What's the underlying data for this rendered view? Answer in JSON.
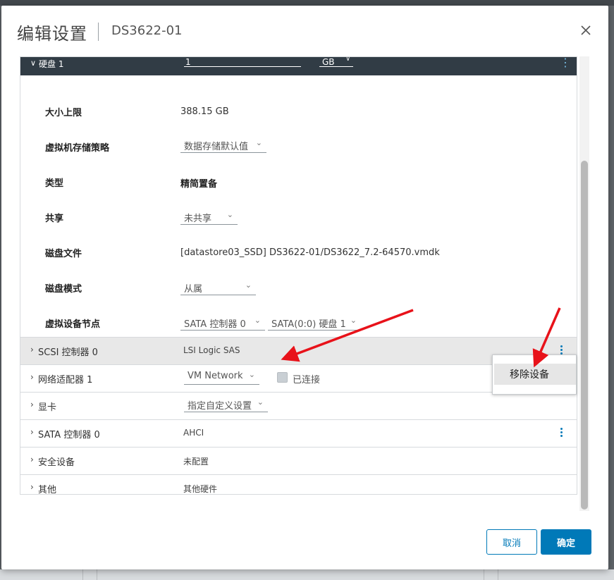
{
  "dialog": {
    "title": "编辑设置",
    "subtitle": "DS3622-01",
    "close_icon": "close-icon"
  },
  "disk_header": {
    "name": "硬盘 1",
    "size_value": "1",
    "unit": "GB"
  },
  "properties": [
    {
      "label": "大小上限",
      "value": "388.15 GB"
    },
    {
      "label": "虚拟机存储策略",
      "value": "数据存储默认值"
    },
    {
      "label": "类型",
      "value": "精简置备"
    },
    {
      "label": "共享",
      "value": "未共享"
    },
    {
      "label": "磁盘文件",
      "value": "[datastore03_SSD] DS3622-01/DS3622_7.2-64570.vmdk"
    },
    {
      "label": "磁盘模式",
      "value": "从属"
    },
    {
      "label": "虚拟设备节点",
      "value": "SATA 控制器 0",
      "value2": "SATA(0:0) 硬盘 1"
    }
  ],
  "rows": [
    {
      "label": "SCSI 控制器 0",
      "value": "LSI Logic SAS"
    },
    {
      "label": "网络适配器 1",
      "value": "VM Network",
      "checkbox_label": "已连接"
    },
    {
      "label": "显卡",
      "value": "指定自定义设置"
    },
    {
      "label": "SATA 控制器 0",
      "value": "AHCI"
    },
    {
      "label": "安全设备",
      "value": "未配置"
    },
    {
      "label": "其他",
      "value": "其他硬件"
    }
  ],
  "context_menu": {
    "item": "移除设备"
  },
  "buttons": {
    "cancel": "取消",
    "ok": "确定"
  },
  "colors": {
    "accent": "#0079b8",
    "header_dark": "#313c45",
    "annotation_arrow": "#e8121a"
  }
}
